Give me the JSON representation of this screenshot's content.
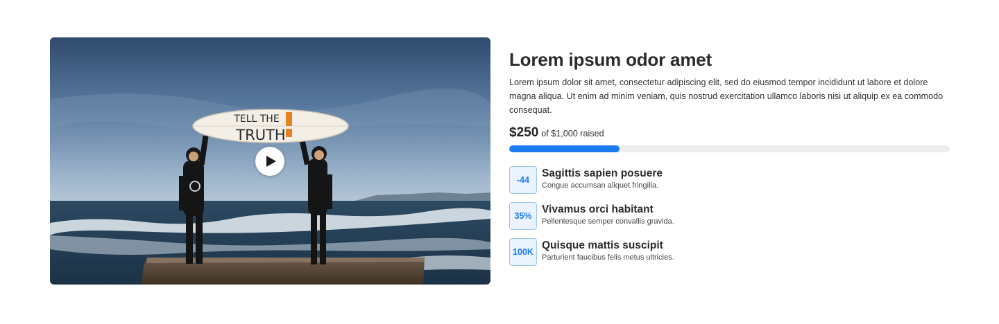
{
  "video": {
    "sign_text_line1": "TELL THE",
    "sign_text_line2": "TRUTH"
  },
  "campaign": {
    "title": "Lorem ipsum odor amet",
    "description": "Lorem ipsum dolor sit amet, consectetur adipiscing elit, sed do eiusmod tempor incididunt ut labore et dolore magna aliqua. Ut enim ad minim veniam, quis nostrud exercitation ullamco laboris nisi ut aliquip ex ea commodo consequat.",
    "raised_amount": "$250",
    "raised_of": "of $1,000 raised",
    "progress_fraction": 0.25,
    "accent_color": "#1a7cf0"
  },
  "stats": [
    {
      "badge": "-44",
      "title": "Sagittis sapien posuere",
      "subtitle": "Congue accumsan aliquet fringilla."
    },
    {
      "badge": "35%",
      "title": "Vivamus orci habitant",
      "subtitle": "Pellentesque semper convallis gravida."
    },
    {
      "badge": "100K",
      "title": "Quisque mattis suscipit",
      "subtitle": "Parturient faucibus felis metus ultricies."
    }
  ]
}
